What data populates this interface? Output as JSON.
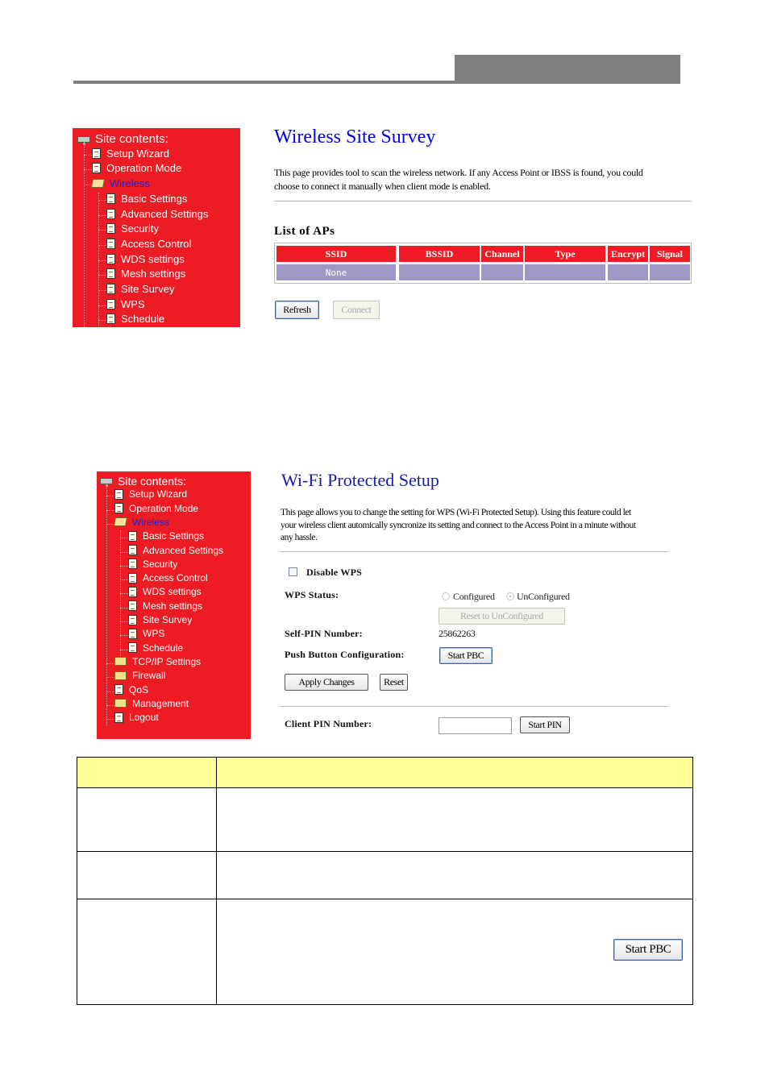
{
  "header": {
    "section_bar": ""
  },
  "sidebar_top": {
    "root_label": "Site contents:",
    "items": [
      {
        "label": "Setup Wizard",
        "icon": "document-icon",
        "level": 1
      },
      {
        "label": "Operation Mode",
        "icon": "document-icon",
        "level": 1
      },
      {
        "label": "Wireless",
        "icon": "folder-open-icon",
        "level": 1,
        "active": true
      },
      {
        "label": "Basic Settings",
        "icon": "document-icon",
        "level": 2
      },
      {
        "label": "Advanced Settings",
        "icon": "document-icon",
        "level": 2
      },
      {
        "label": "Security",
        "icon": "document-icon",
        "level": 2
      },
      {
        "label": "Access Control",
        "icon": "document-icon",
        "level": 2
      },
      {
        "label": "WDS settings",
        "icon": "document-icon",
        "level": 2
      },
      {
        "label": "Mesh settings",
        "icon": "document-icon",
        "level": 2
      },
      {
        "label": "Site Survey",
        "icon": "document-icon",
        "level": 2
      },
      {
        "label": "WPS",
        "icon": "document-icon",
        "level": 2
      },
      {
        "label": "Schedule",
        "icon": "document-icon",
        "level": 2
      }
    ]
  },
  "site_survey": {
    "title": "Wireless Site Survey",
    "description_line1": "This page provides tool to scan the wireless network. If any Access Point or IBSS is found, you could",
    "description_line2": "choose to connect it manually when client mode is enabled.",
    "list_title": "List of APs",
    "columns": [
      "SSID",
      "BSSID",
      "Channel",
      "Type",
      "Encrypt",
      "Signal"
    ],
    "rows": [
      [
        "None",
        "",
        "",
        "",
        "",
        ""
      ]
    ],
    "refresh_button": "Refresh",
    "connect_button": "Connect"
  },
  "sidebar_bottom": {
    "root_label": "Site contents:",
    "items": [
      {
        "label": "Setup Wizard",
        "icon": "document-icon",
        "level": 1
      },
      {
        "label": "Operation Mode",
        "icon": "document-icon",
        "level": 1
      },
      {
        "label": "Wireless",
        "icon": "folder-open-icon",
        "level": 1,
        "active": true
      },
      {
        "label": "Basic Settings",
        "icon": "document-icon",
        "level": 2
      },
      {
        "label": "Advanced Settings",
        "icon": "document-icon",
        "level": 2
      },
      {
        "label": "Security",
        "icon": "document-icon",
        "level": 2
      },
      {
        "label": "Access Control",
        "icon": "document-icon",
        "level": 2
      },
      {
        "label": "WDS settings",
        "icon": "document-icon",
        "level": 2
      },
      {
        "label": "Mesh settings",
        "icon": "document-icon",
        "level": 2
      },
      {
        "label": "Site Survey",
        "icon": "document-icon",
        "level": 2
      },
      {
        "label": "WPS",
        "icon": "document-icon",
        "level": 2
      },
      {
        "label": "Schedule",
        "icon": "document-icon",
        "level": 2
      },
      {
        "label": "TCP/IP Settings",
        "icon": "folder-icon",
        "level": 1
      },
      {
        "label": "Firewall",
        "icon": "folder-icon",
        "level": 1
      },
      {
        "label": "QoS",
        "icon": "document-icon",
        "level": 1
      },
      {
        "label": "Management",
        "icon": "folder-icon",
        "level": 1
      },
      {
        "label": "Logout",
        "icon": "document-icon",
        "level": 1
      }
    ]
  },
  "wps": {
    "title": "Wi-Fi Protected Setup",
    "description_line1": "This page allows you to change the setting for WPS (Wi-Fi Protected Setup). Using this feature could let",
    "description_line2": "your wireless client automically syncronize its setting and connect to the Access Point in a minute without",
    "description_line3": "any hassle.",
    "disable_wps_label": "Disable WPS",
    "disable_wps_checked": false,
    "wps_status_label": "WPS Status:",
    "status_options": [
      "Configured",
      "UnConfigured"
    ],
    "status_selected": "UnConfigured",
    "reset_unconfigured_button": "Reset to UnConfigured",
    "self_pin_label": "Self-PIN Number:",
    "self_pin_value": "25862263",
    "pbc_label": "Push Button Configuration:",
    "start_pbc_button": "Start PBC",
    "apply_button": "Apply Changes",
    "reset_button": "Reset",
    "client_pin_label": "Client PIN Number:",
    "client_pin_value": "",
    "start_pin_button": "Start PIN"
  },
  "doc_table": {
    "header": [
      "",
      ""
    ],
    "rows": [
      {
        "label": "",
        "desc": ""
      },
      {
        "label": "",
        "desc": ""
      },
      {
        "label": "",
        "desc": "",
        "button": "Start PBC"
      }
    ]
  },
  "colors": {
    "sidebar_bg": "#ed1c24",
    "active_item": "#2222cc",
    "title_blue": "#0000ee",
    "table_header": "#ed1c24",
    "table_row": "#9e98c6",
    "doc_header": "#ffff99"
  }
}
